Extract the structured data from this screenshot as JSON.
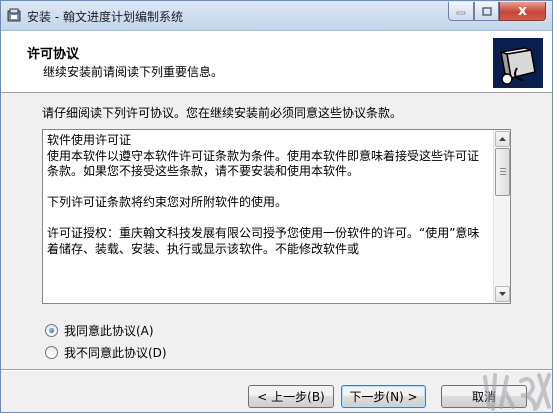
{
  "window": {
    "title": "安装 - 翰文进度计划编制系统",
    "close_glyph": "x"
  },
  "header": {
    "title": "许可协议",
    "subtitle": "继续安装前请阅读下列重要信息。"
  },
  "instruction": "请仔细阅读下列许可协议。您在继续安装前必须同意这些协议条款。",
  "license": {
    "paragraphs": [
      "软件使用许可证\n使用本软件以遵守本软件许可证条款为条件。使用本软件即意味着接受这些许可证条款。如果您不接受这些条款，请不要安装和使用本软件。",
      "下列许可证条款将约束您对所附软件的使用。",
      "许可证授权：重庆翰文科技发展有限公司授予您使用一份软件的许可。“使用”意味着储存、装载、安装、执行或显示该软件。不能修改软件或"
    ]
  },
  "options": {
    "accept": {
      "label": "我同意此协议(A)",
      "checked": true
    },
    "decline": {
      "label": "我不同意此协议(D)",
      "checked": false
    }
  },
  "buttons": {
    "back": "< 上一步(B)",
    "next": "下一步(N) >",
    "cancel": "取消"
  },
  "colors": {
    "titlebar": "#c4d6ec",
    "close_button": "#c7463a",
    "dialog_bg": "#f0f0f0",
    "default_button_border": "#3c7fb1"
  },
  "icons": {
    "app": "installer-app-icon",
    "header": "installer-box-icon",
    "watermark": "site-logo-watermark"
  }
}
